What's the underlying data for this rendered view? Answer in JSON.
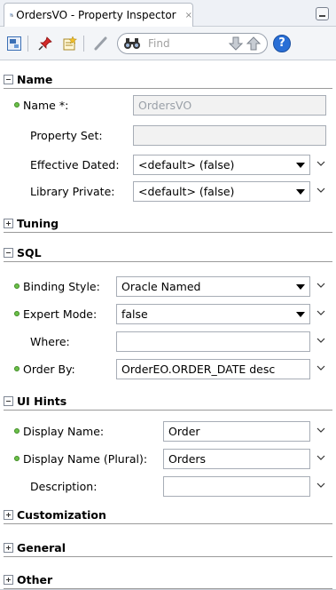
{
  "tab": {
    "title": "OrdersVO - Property Inspector",
    "close_glyph": "×"
  },
  "toolbar": {
    "icons": [
      "frame-icon",
      "pin-icon",
      "edit-source-icon",
      "pencil-icon",
      "binoculars-icon",
      "find-down-icon",
      "find-up-icon",
      "help-icon"
    ],
    "search_placeholder": "Find",
    "help_label": "?"
  },
  "sections": {
    "name": {
      "title": "Name",
      "rows": {
        "name": {
          "label": "Name *:",
          "value": "OrdersVO"
        },
        "property_set": {
          "label": "Property Set:",
          "value": ""
        },
        "effective_dated": {
          "label": "Effective Dated:",
          "value": "<default> (false)"
        },
        "library_private": {
          "label": "Library Private:",
          "value": "<default> (false)"
        }
      }
    },
    "tuning": {
      "title": "Tuning"
    },
    "sql": {
      "title": "SQL",
      "rows": {
        "binding_style": {
          "label": "Binding Style:",
          "value": "Oracle Named"
        },
        "expert_mode": {
          "label": "Expert Mode:",
          "value": "false"
        },
        "where": {
          "label": "Where:",
          "value": ""
        },
        "order_by": {
          "label": "Order By:",
          "value": "OrderEO.ORDER_DATE desc"
        }
      }
    },
    "ui_hints": {
      "title": "UI Hints",
      "rows": {
        "display_name": {
          "label": "Display Name:",
          "value": "Order"
        },
        "display_name_plural": {
          "label": "Display Name (Plural):",
          "value": "Orders"
        },
        "description": {
          "label": "Description:",
          "value": ""
        }
      }
    },
    "customization": {
      "title": "Customization"
    },
    "general": {
      "title": "General"
    },
    "other": {
      "title": "Other"
    }
  },
  "colors": {
    "required_dot": "#6cc04a",
    "help": "#2a6fd6",
    "pin": "#d42a2a"
  }
}
